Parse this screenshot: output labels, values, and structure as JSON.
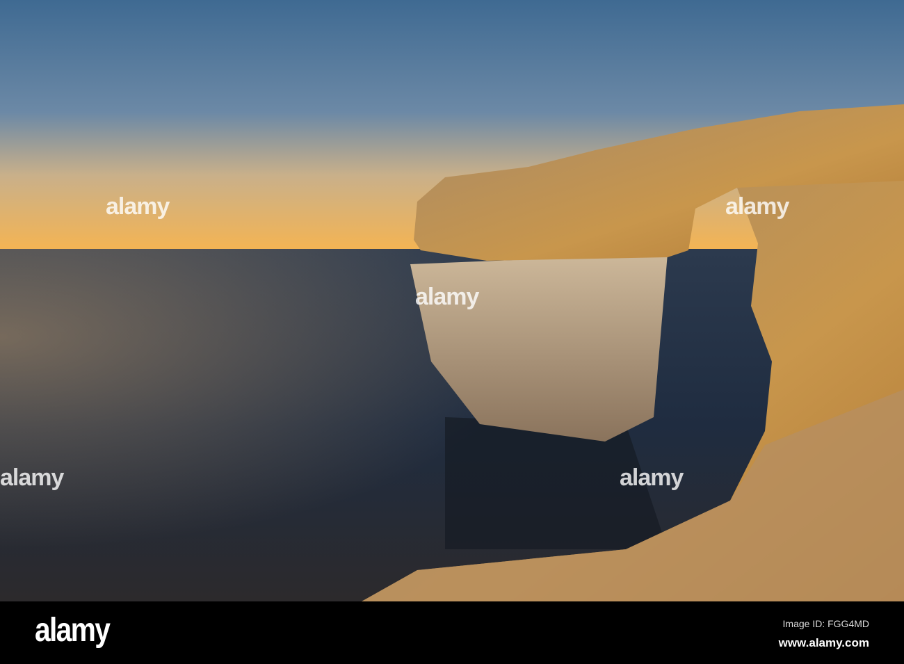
{
  "photo": {
    "subject": "Azure Window sea arch at sunset",
    "colors": {
      "sky_top": "#4a6d93",
      "sky_horizon": "#f2b552",
      "sea": "#1e2c40",
      "rock": "#c9954a"
    }
  },
  "watermark": {
    "text": "alamy"
  },
  "footer": {
    "logo": "alamy",
    "image_id": "Image ID: FGG4MD",
    "site": "www.alamy.com"
  }
}
